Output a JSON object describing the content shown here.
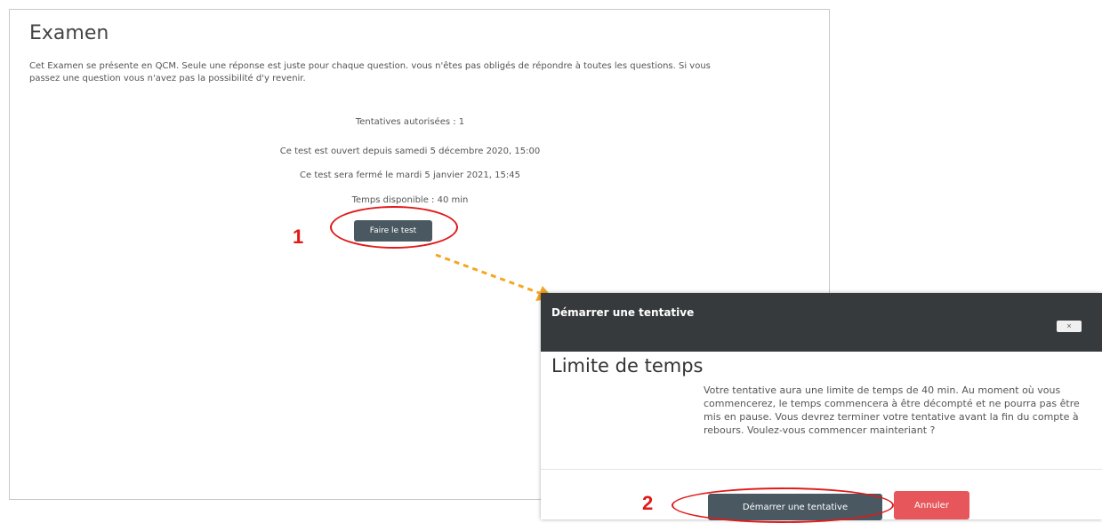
{
  "quiz": {
    "title": "Examen",
    "description": "Cet Examen se présente en QCM. Seule une réponse est juste pour chaque question. vous n'êtes pas obligés de répondre à toutes les questions. Si vous passez une question vous n'avez pas la possibilité d'y revenir.",
    "info": [
      "Tentatives autorisées : 1",
      "Ce test est ouvert depuis samedi 5 décembre 2020, 15:00",
      "Ce test sera fermé le mardi 5 janvier 2021, 15:45",
      "Temps disponible : 40 min"
    ],
    "start_button": "Faire le test"
  },
  "annotations": {
    "step1": "1",
    "step2": "2",
    "color": "#e01919",
    "arrow_color": "#f5a623"
  },
  "modal": {
    "title": "Démarrer une tentative",
    "close_label": "×",
    "heading": "Limite de temps",
    "text": "Votre tentative aura une limite de temps de 40 min. Au moment où vous commencerez, le temps commencera à être décompté et ne pourra pas être mis en pause. Vous devrez terminer votre tentative avant la fin du compte à rebours. Voulez-vous commencer mainteriant ?",
    "start_button": "Démarrer une tentative",
    "cancel_button": "Annuler"
  },
  "colors": {
    "primary_button": "#4a5861",
    "cancel_button": "#e6565a",
    "modal_header": "#373a3c"
  }
}
